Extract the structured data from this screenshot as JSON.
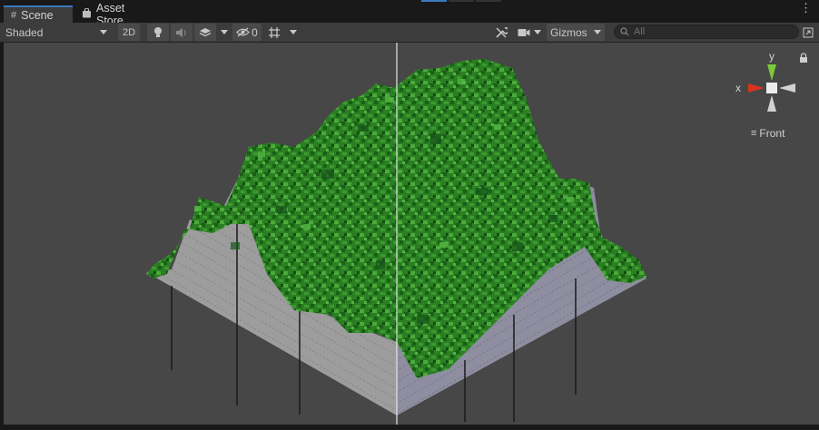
{
  "tabs": [
    {
      "label": "Scene",
      "icon": "hash-icon"
    },
    {
      "label": "Asset Store",
      "icon": "bag-icon"
    }
  ],
  "toolbar": {
    "shading_mode": "Shaded",
    "mode_2d": "2D",
    "hidden_count": "0",
    "gizmos_label": "Gizmos",
    "search_placeholder": "All"
  },
  "gizmo": {
    "axis_y": "y",
    "axis_x": "x",
    "view_label": "Front"
  },
  "colors": {
    "grass_dark": "#1e6b1a",
    "grass_mid": "#2f8a26",
    "grass_light": "#4cab3c",
    "wall_left": "#9a9a9a",
    "wall_right": "#8d8d9c",
    "axis_y": "#7ec83a",
    "axis_x": "#d8341e",
    "tab_accent": "#3a79bb"
  }
}
